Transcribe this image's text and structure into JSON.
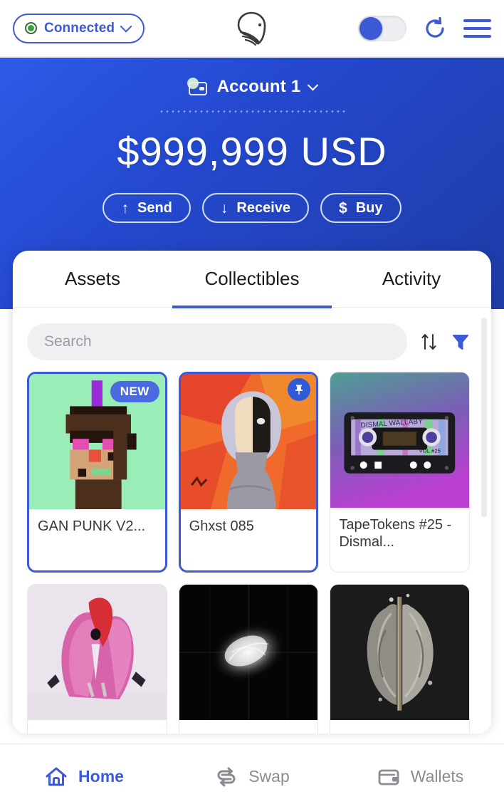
{
  "topbar": {
    "connection_label": "Connected",
    "connection_status_color": "#3f9e3f",
    "chevron_icon": "chevron-down-icon",
    "logo_icon": "whale-logo-icon",
    "toggle_state": "off",
    "refresh_icon": "refresh-icon",
    "menu_icon": "hamburger-menu-icon",
    "accent_color": "#3c5ad6"
  },
  "hero": {
    "account_icon": "wallet-icon",
    "account_name": "Account 1",
    "account_chevron": "chevron-down-icon",
    "balance": "$999,999 USD",
    "actions": [
      {
        "icon": "arrow-up-icon",
        "glyph": "↑",
        "label": "Send"
      },
      {
        "icon": "arrow-down-icon",
        "glyph": "↓",
        "label": "Receive"
      },
      {
        "icon": "dollar-icon",
        "glyph": "$",
        "label": "Buy"
      }
    ],
    "gradient_from": "#2d5ae8",
    "gradient_to": "#1f3ba6"
  },
  "sheet": {
    "tabs": [
      {
        "label": "Assets",
        "active": false
      },
      {
        "label": "Collectibles",
        "active": true
      },
      {
        "label": "Activity",
        "active": false
      }
    ],
    "search": {
      "placeholder": "Search",
      "value": "",
      "sort_icon": "sort-arrows-icon",
      "filter_icon": "filter-funnel-icon",
      "filter_color": "#3c5ad6"
    },
    "collectibles": [
      {
        "name": "GAN PUNK V2...",
        "art": "pixel-punk-green",
        "badge": "NEW",
        "badge_type": "new",
        "selected": true
      },
      {
        "name": "Ghxst 085",
        "art": "ghost-portrait-orange",
        "badge": "",
        "badge_type": "pin",
        "selected": true
      },
      {
        "name": "TapeTokens #25 - Dismal...",
        "art": "cassette-tape-gradient",
        "badge": "",
        "badge_type": "none",
        "selected": false,
        "art_text": "DISMAL WALLABY",
        "art_subtext": "VOL #25"
      },
      {
        "name": "",
        "art": "pink-feather-creature",
        "badge": "",
        "badge_type": "none",
        "selected": false
      },
      {
        "name": "",
        "art": "white-smoke-black",
        "badge": "",
        "badge_type": "none",
        "selected": false
      },
      {
        "name": "",
        "art": "stone-sculpture-dark",
        "badge": "",
        "badge_type": "none",
        "selected": false
      }
    ]
  },
  "bottom_nav": [
    {
      "icon": "home-icon",
      "label": "Home",
      "active": true
    },
    {
      "icon": "swap-icon",
      "label": "Swap",
      "active": false
    },
    {
      "icon": "wallets-icon",
      "label": "Wallets",
      "active": false
    }
  ]
}
